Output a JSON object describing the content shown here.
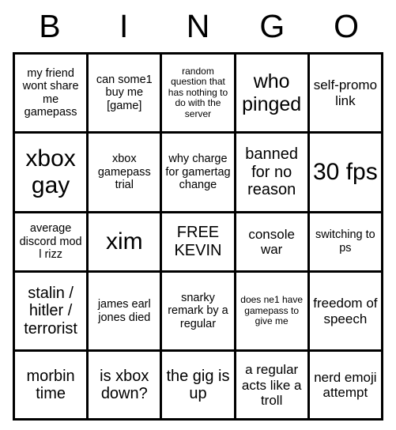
{
  "card": {
    "header_letters": [
      "B",
      "I",
      "N",
      "G",
      "O"
    ],
    "colors": {
      "background": "#ffffff",
      "text": "#000000",
      "grid_line": "#000000"
    },
    "rows": [
      [
        {
          "text": "my friend wont share me gamepass",
          "size": "sz-s"
        },
        {
          "text": "can some1 buy me [game]",
          "size": "sz-s"
        },
        {
          "text": "random question that has nothing to do with the server",
          "size": "sz-xs"
        },
        {
          "text": "who pinged",
          "size": "sz-xl"
        },
        {
          "text": "self-promo link",
          "size": "sz-m"
        }
      ],
      [
        {
          "text": "xbox gay",
          "size": "sz-xxl"
        },
        {
          "text": "xbox gamepass trial",
          "size": "sz-s"
        },
        {
          "text": "why charge for gamertag change",
          "size": "sz-s"
        },
        {
          "text": "banned for no reason",
          "size": "sz-l"
        },
        {
          "text": "30 fps",
          "size": "sz-xxl"
        }
      ],
      [
        {
          "text": "average discord mod l rizz",
          "size": "sz-s"
        },
        {
          "text": "xim",
          "size": "sz-xxl"
        },
        {
          "text": "FREE KEVIN",
          "size": "sz-l"
        },
        {
          "text": "console war",
          "size": "sz-m"
        },
        {
          "text": "switching to ps",
          "size": "sz-s"
        }
      ],
      [
        {
          "text": "stalin / hitler / terrorist",
          "size": "sz-l"
        },
        {
          "text": "james earl jones died",
          "size": "sz-s"
        },
        {
          "text": "snarky remark by a regular",
          "size": "sz-s"
        },
        {
          "text": "does ne1 have gamepass to give me",
          "size": "sz-xs"
        },
        {
          "text": "freedom of speech",
          "size": "sz-m"
        }
      ],
      [
        {
          "text": "morbin time",
          "size": "sz-l"
        },
        {
          "text": "is xbox down?",
          "size": "sz-l"
        },
        {
          "text": "the gig is up",
          "size": "sz-l"
        },
        {
          "text": "a regular acts like a troll",
          "size": "sz-m"
        },
        {
          "text": "nerd emoji attempt",
          "size": "sz-m"
        }
      ]
    ]
  }
}
